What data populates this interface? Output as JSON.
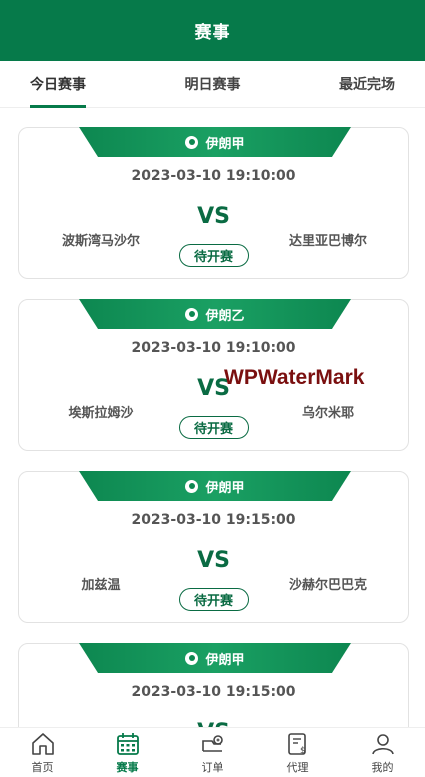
{
  "header": {
    "title": "赛事"
  },
  "tabs": [
    {
      "label": "今日赛事",
      "active": true
    },
    {
      "label": "明日赛事",
      "active": false
    },
    {
      "label": "最近完场",
      "active": false
    }
  ],
  "matches": [
    {
      "league": "伊朗甲",
      "time": "2023-03-10 19:10:00",
      "vs": "VS",
      "home": "波斯湾马沙尔",
      "away": "达里亚巴博尔",
      "status": "待开赛"
    },
    {
      "league": "伊朗乙",
      "time": "2023-03-10 19:10:00",
      "vs": "VS",
      "home": "埃斯拉姆沙",
      "away": "乌尔米耶",
      "status": "待开赛"
    },
    {
      "league": "伊朗甲",
      "time": "2023-03-10 19:15:00",
      "vs": "VS",
      "home": "加兹温",
      "away": "沙赫尔巴巴克",
      "status": "待开赛"
    },
    {
      "league": "伊朗甲",
      "time": "2023-03-10 19:15:00",
      "vs": "VS",
      "home": "",
      "away": "",
      "status": ""
    }
  ],
  "watermark": "WPWaterMark",
  "bottom_nav": [
    {
      "label": "首页",
      "icon": "home-icon"
    },
    {
      "label": "赛事",
      "icon": "calendar-icon",
      "active": true
    },
    {
      "label": "订单",
      "icon": "order-icon"
    },
    {
      "label": "代理",
      "icon": "agent-icon"
    },
    {
      "label": "我的",
      "icon": "user-icon"
    }
  ],
  "colors": {
    "primary": "#067a4a",
    "banner": "#0d8750",
    "text": "#555555"
  }
}
